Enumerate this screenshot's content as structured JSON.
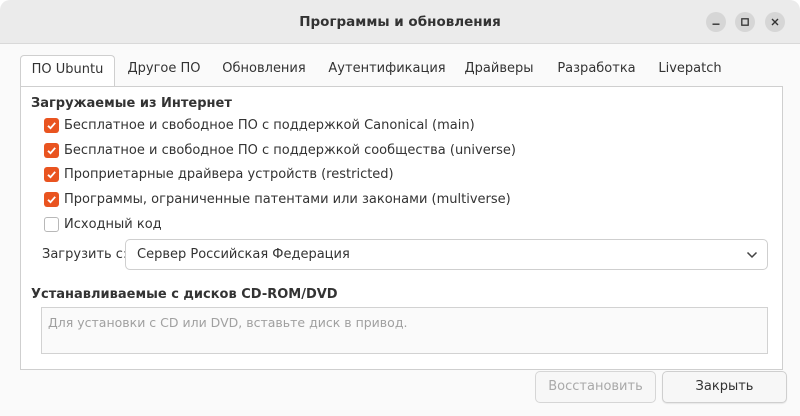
{
  "window": {
    "title": "Программы и обновления"
  },
  "tabs": [
    {
      "label": "ПО Ubuntu",
      "active": true
    },
    {
      "label": "Другое ПО",
      "active": false
    },
    {
      "label": "Обновления",
      "active": false
    },
    {
      "label": "Аутентификация",
      "active": false
    },
    {
      "label": "Драйверы",
      "active": false
    },
    {
      "label": "Разработка",
      "active": false
    },
    {
      "label": "Livepatch",
      "active": false
    }
  ],
  "internet": {
    "heading": "Загружаемые из Интернет",
    "options": [
      {
        "label": "Бесплатное и свободное ПО с поддержкой Canonical (main)",
        "checked": true
      },
      {
        "label": "Бесплатное и свободное ПО с поддержкой сообщества (universe)",
        "checked": true
      },
      {
        "label": "Проприетарные драйвера устройств (restricted)",
        "checked": true
      },
      {
        "label": "Программы, ограниченные патентами или законами (multiverse)",
        "checked": true
      },
      {
        "label": "Исходный код",
        "checked": false
      }
    ],
    "download_from_label": "Загрузить с:",
    "download_from_value": "Сервер Российская Федерация"
  },
  "cdrom": {
    "heading": "Устанавливаемые с дисков CD-ROM/DVD",
    "placeholder": "Для установки с CD или DVD, вставьте диск в привод."
  },
  "buttons": {
    "restore": "Восстановить",
    "close": "Закрыть"
  },
  "colors": {
    "accent": "#e95420",
    "titlebar": "#ebebeb"
  },
  "icons": {
    "minimize": "minimize-icon",
    "maximize": "maximize-icon",
    "close": "close-icon",
    "dropdown": "chevron-down-icon",
    "check": "checkmark-icon"
  }
}
